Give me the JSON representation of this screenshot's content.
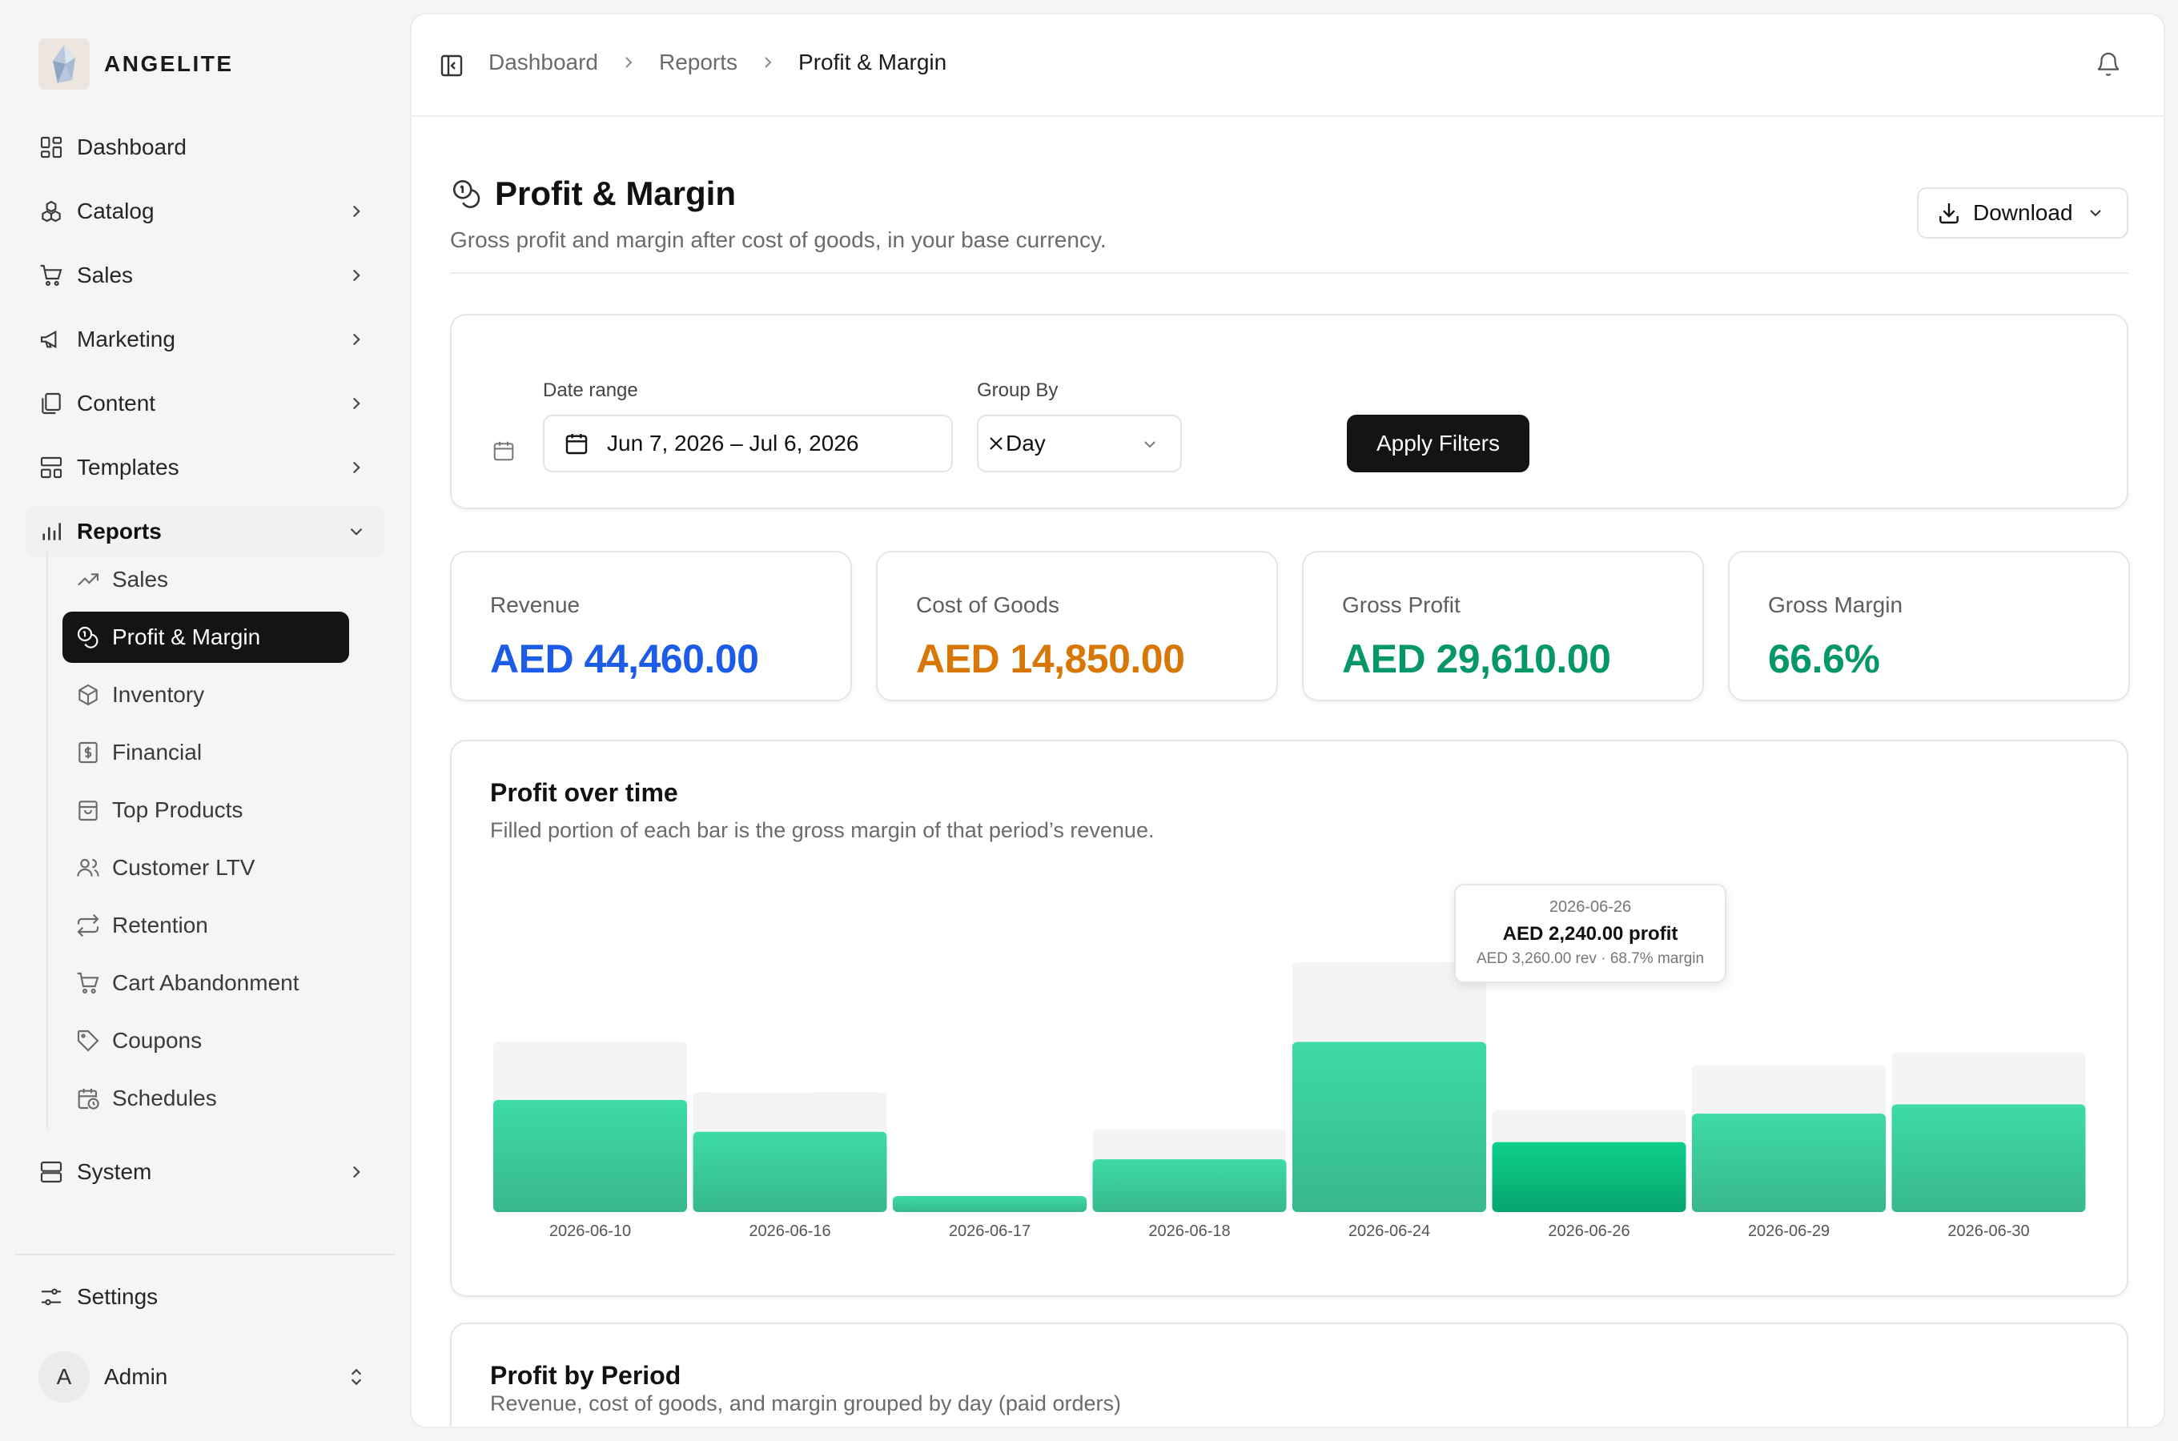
{
  "brand": {
    "name": "ANGELITE"
  },
  "sidebar": {
    "items": [
      {
        "label": "Dashboard",
        "icon": "dashboard-icon"
      },
      {
        "label": "Catalog",
        "icon": "catalog-icon"
      },
      {
        "label": "Sales",
        "icon": "cart-icon"
      },
      {
        "label": "Marketing",
        "icon": "megaphone-icon"
      },
      {
        "label": "Content",
        "icon": "files-icon"
      },
      {
        "label": "Templates",
        "icon": "layout-icon"
      },
      {
        "label": "Reports",
        "icon": "bar-chart-icon"
      },
      {
        "label": "System",
        "icon": "server-icon"
      }
    ],
    "report_items": [
      {
        "label": "Sales",
        "icon": "trend-icon"
      },
      {
        "label": "Profit & Margin",
        "icon": "coins-icon"
      },
      {
        "label": "Inventory",
        "icon": "package-icon"
      },
      {
        "label": "Financial",
        "icon": "receipt-icon"
      },
      {
        "label": "Top Products",
        "icon": "bag-icon"
      },
      {
        "label": "Customer LTV",
        "icon": "users-icon"
      },
      {
        "label": "Retention",
        "icon": "repeat-icon"
      },
      {
        "label": "Cart Abandonment",
        "icon": "cart-icon"
      },
      {
        "label": "Coupons",
        "icon": "tag-icon"
      },
      {
        "label": "Schedules",
        "icon": "calendar-clock-icon"
      }
    ],
    "settings_label": "Settings",
    "user": {
      "initial": "A",
      "name": "Admin"
    }
  },
  "breadcrumb": [
    "Dashboard",
    "Reports",
    "Profit & Margin"
  ],
  "page": {
    "title": "Profit & Margin",
    "subtitle": "Gross profit and margin after cost of goods, in your base currency.",
    "download_label": "Download"
  },
  "filters": {
    "date_label": "Date range",
    "date_value": "Jun 7, 2026 – Jul 6, 2026",
    "group_label": "Group By",
    "group_value": "Day",
    "apply_label": "Apply Filters"
  },
  "stats": [
    {
      "label": "Revenue",
      "value": "AED 44,460.00",
      "color": "#1d5ce6"
    },
    {
      "label": "Cost of Goods",
      "value": "AED 14,850.00",
      "color": "#d97706"
    },
    {
      "label": "Gross Profit",
      "value": "AED 29,610.00",
      "color": "#059669"
    },
    {
      "label": "Gross Margin",
      "value": "66.6%",
      "color": "#059669"
    }
  ],
  "chart": {
    "title": "Profit over time",
    "subtitle": "Filled portion of each bar is the gross margin of that period’s revenue.",
    "tooltip": {
      "date": "2026-06-26",
      "main": "AED 2,240.00 profit",
      "meta": "AED 3,260.00 rev · 68.7% margin"
    }
  },
  "chart_data": {
    "type": "bar",
    "categories": [
      "2026-06-10",
      "2026-06-16",
      "2026-06-17",
      "2026-06-18",
      "2026-06-24",
      "2026-06-26",
      "2026-06-29",
      "2026-06-30"
    ],
    "series": [
      {
        "values": [
          5450,
          3830,
          500,
          2640,
          8000,
          3260,
          4710,
          5120
        ]
      },
      {
        "values": [
          3590,
          2570,
          500,
          1690,
          5450,
          2240,
          3150,
          3450
        ]
      }
    ],
    "highlight_index": 5,
    "colors": {
      "revenue": "#f4f4f4",
      "profit_top": "#3ddba6",
      "profit_bottom": "#38b88a",
      "profit_active_top": "#0fcf8a",
      "profit_active_bottom": "#06a56d"
    }
  },
  "period": {
    "title": "Profit by Period",
    "subtitle": "Revenue, cost of goods, and margin grouped by day (paid orders)"
  }
}
